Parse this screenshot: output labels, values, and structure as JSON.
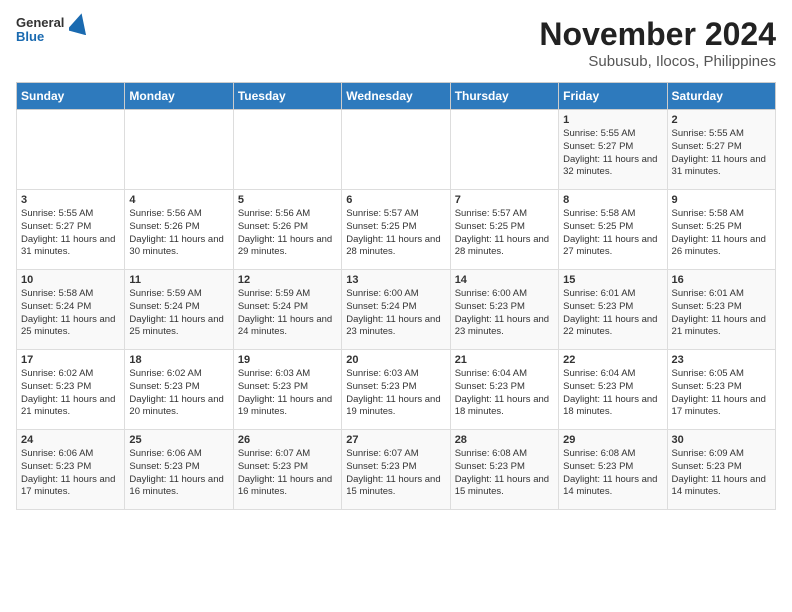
{
  "header": {
    "logo_general": "General",
    "logo_blue": "Blue",
    "title": "November 2024",
    "subtitle": "Subusub, Ilocos, Philippines"
  },
  "calendar": {
    "days_of_week": [
      "Sunday",
      "Monday",
      "Tuesday",
      "Wednesday",
      "Thursday",
      "Friday",
      "Saturday"
    ],
    "weeks": [
      [
        {
          "day": "",
          "info": ""
        },
        {
          "day": "",
          "info": ""
        },
        {
          "day": "",
          "info": ""
        },
        {
          "day": "",
          "info": ""
        },
        {
          "day": "",
          "info": ""
        },
        {
          "day": "1",
          "info": "Sunrise: 5:55 AM\nSunset: 5:27 PM\nDaylight: 11 hours and 32 minutes."
        },
        {
          "day": "2",
          "info": "Sunrise: 5:55 AM\nSunset: 5:27 PM\nDaylight: 11 hours and 31 minutes."
        }
      ],
      [
        {
          "day": "3",
          "info": "Sunrise: 5:55 AM\nSunset: 5:27 PM\nDaylight: 11 hours and 31 minutes."
        },
        {
          "day": "4",
          "info": "Sunrise: 5:56 AM\nSunset: 5:26 PM\nDaylight: 11 hours and 30 minutes."
        },
        {
          "day": "5",
          "info": "Sunrise: 5:56 AM\nSunset: 5:26 PM\nDaylight: 11 hours and 29 minutes."
        },
        {
          "day": "6",
          "info": "Sunrise: 5:57 AM\nSunset: 5:25 PM\nDaylight: 11 hours and 28 minutes."
        },
        {
          "day": "7",
          "info": "Sunrise: 5:57 AM\nSunset: 5:25 PM\nDaylight: 11 hours and 28 minutes."
        },
        {
          "day": "8",
          "info": "Sunrise: 5:58 AM\nSunset: 5:25 PM\nDaylight: 11 hours and 27 minutes."
        },
        {
          "day": "9",
          "info": "Sunrise: 5:58 AM\nSunset: 5:25 PM\nDaylight: 11 hours and 26 minutes."
        }
      ],
      [
        {
          "day": "10",
          "info": "Sunrise: 5:58 AM\nSunset: 5:24 PM\nDaylight: 11 hours and 25 minutes."
        },
        {
          "day": "11",
          "info": "Sunrise: 5:59 AM\nSunset: 5:24 PM\nDaylight: 11 hours and 25 minutes."
        },
        {
          "day": "12",
          "info": "Sunrise: 5:59 AM\nSunset: 5:24 PM\nDaylight: 11 hours and 24 minutes."
        },
        {
          "day": "13",
          "info": "Sunrise: 6:00 AM\nSunset: 5:24 PM\nDaylight: 11 hours and 23 minutes."
        },
        {
          "day": "14",
          "info": "Sunrise: 6:00 AM\nSunset: 5:23 PM\nDaylight: 11 hours and 23 minutes."
        },
        {
          "day": "15",
          "info": "Sunrise: 6:01 AM\nSunset: 5:23 PM\nDaylight: 11 hours and 22 minutes."
        },
        {
          "day": "16",
          "info": "Sunrise: 6:01 AM\nSunset: 5:23 PM\nDaylight: 11 hours and 21 minutes."
        }
      ],
      [
        {
          "day": "17",
          "info": "Sunrise: 6:02 AM\nSunset: 5:23 PM\nDaylight: 11 hours and 21 minutes."
        },
        {
          "day": "18",
          "info": "Sunrise: 6:02 AM\nSunset: 5:23 PM\nDaylight: 11 hours and 20 minutes."
        },
        {
          "day": "19",
          "info": "Sunrise: 6:03 AM\nSunset: 5:23 PM\nDaylight: 11 hours and 19 minutes."
        },
        {
          "day": "20",
          "info": "Sunrise: 6:03 AM\nSunset: 5:23 PM\nDaylight: 11 hours and 19 minutes."
        },
        {
          "day": "21",
          "info": "Sunrise: 6:04 AM\nSunset: 5:23 PM\nDaylight: 11 hours and 18 minutes."
        },
        {
          "day": "22",
          "info": "Sunrise: 6:04 AM\nSunset: 5:23 PM\nDaylight: 11 hours and 18 minutes."
        },
        {
          "day": "23",
          "info": "Sunrise: 6:05 AM\nSunset: 5:23 PM\nDaylight: 11 hours and 17 minutes."
        }
      ],
      [
        {
          "day": "24",
          "info": "Sunrise: 6:06 AM\nSunset: 5:23 PM\nDaylight: 11 hours and 17 minutes."
        },
        {
          "day": "25",
          "info": "Sunrise: 6:06 AM\nSunset: 5:23 PM\nDaylight: 11 hours and 16 minutes."
        },
        {
          "day": "26",
          "info": "Sunrise: 6:07 AM\nSunset: 5:23 PM\nDaylight: 11 hours and 16 minutes."
        },
        {
          "day": "27",
          "info": "Sunrise: 6:07 AM\nSunset: 5:23 PM\nDaylight: 11 hours and 15 minutes."
        },
        {
          "day": "28",
          "info": "Sunrise: 6:08 AM\nSunset: 5:23 PM\nDaylight: 11 hours and 15 minutes."
        },
        {
          "day": "29",
          "info": "Sunrise: 6:08 AM\nSunset: 5:23 PM\nDaylight: 11 hours and 14 minutes."
        },
        {
          "day": "30",
          "info": "Sunrise: 6:09 AM\nSunset: 5:23 PM\nDaylight: 11 hours and 14 minutes."
        }
      ]
    ]
  }
}
